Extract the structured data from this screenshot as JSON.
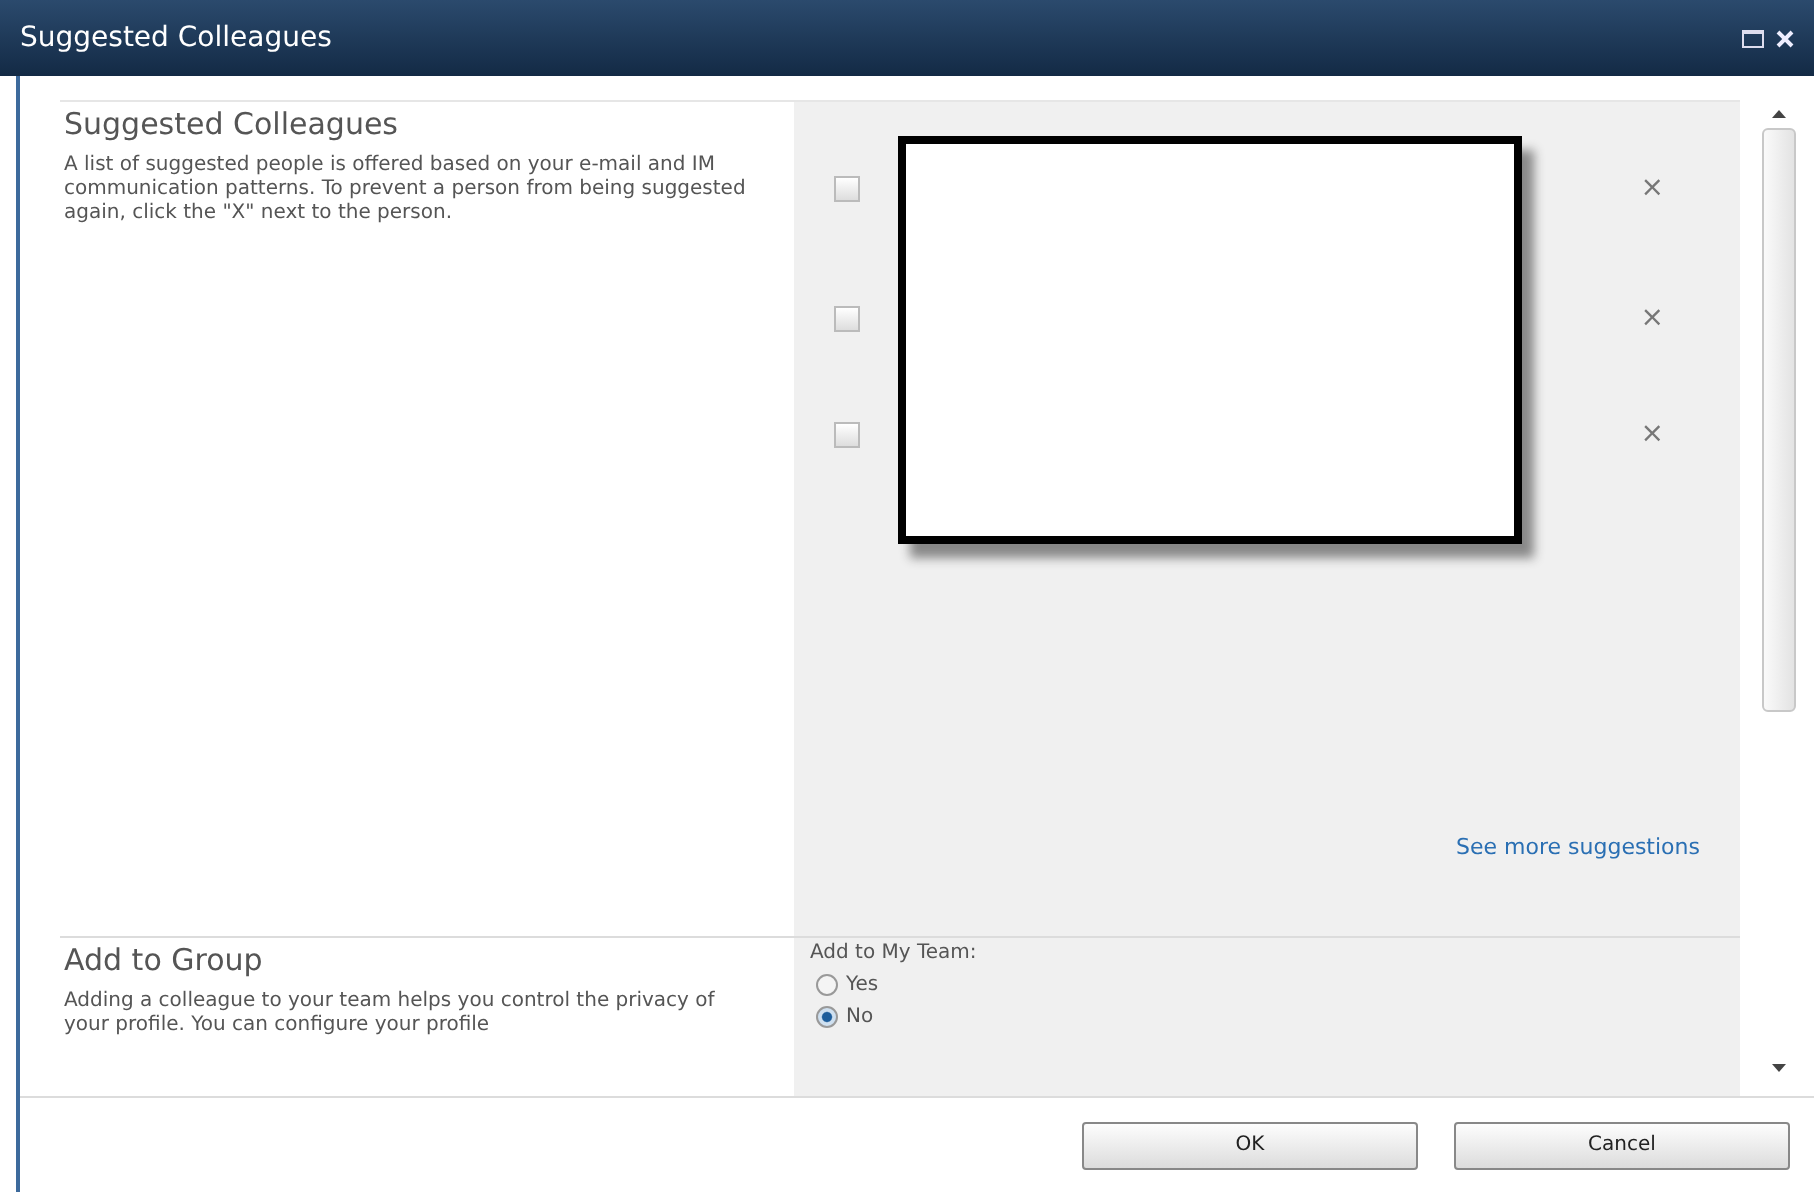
{
  "window": {
    "title": "Suggested Colleagues"
  },
  "sections": [
    {
      "heading": "Suggested Colleagues",
      "description": "A list of suggested people is offered based on your e-mail and IM communication patterns. To prevent a person from being suggested again, click the \"X\" next to the person."
    },
    {
      "heading": "Add to Group",
      "description": "Adding a colleague to your team helps you control the privacy of your profile. You can configure your profile"
    }
  ],
  "suggestions": [
    {
      "checked": false,
      "remove": "×"
    },
    {
      "checked": false,
      "remove": "×"
    },
    {
      "checked": false,
      "remove": "×"
    }
  ],
  "see_more_link": "See more suggestions",
  "add_to_team": {
    "label": "Add to My Team:",
    "options": [
      {
        "label": "Yes",
        "selected": false
      },
      {
        "label": "No",
        "selected": true
      }
    ]
  },
  "buttons": [
    "OK",
    "Cancel"
  ]
}
